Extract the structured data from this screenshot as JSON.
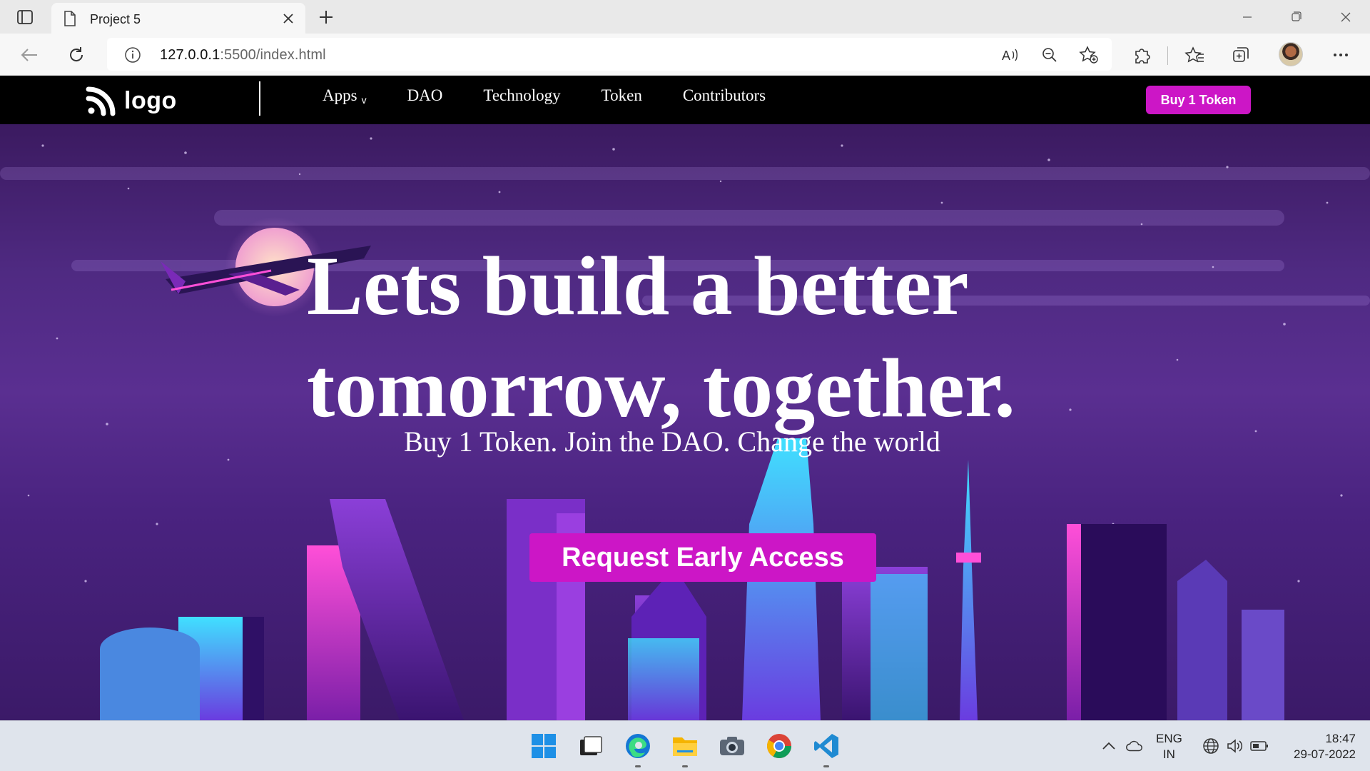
{
  "browser": {
    "tab_title": "Project 5",
    "url_host": "127.0.0.1",
    "url_path": ":5500/index.html"
  },
  "site": {
    "logo_text": "logo",
    "nav": [
      {
        "label": "Apps",
        "caret": "v"
      },
      {
        "label": "DAO"
      },
      {
        "label": "Technology"
      },
      {
        "label": "Token"
      },
      {
        "label": "Contributors"
      }
    ],
    "buy_button": "Buy 1 Token",
    "hero": {
      "title_line1": "Lets build a better",
      "title_line2": "tomorrow, together.",
      "subtitle": "Buy 1 Token. Join the DAO. Change the world",
      "cta": "Request Early Access"
    },
    "colors": {
      "accent": "#cc16c6",
      "nav_bg": "#000000",
      "hero_bg": "#4f2a82"
    }
  },
  "taskbar": {
    "lang_line1": "ENG",
    "lang_line2": "IN",
    "time": "18:47",
    "date": "29-07-2022",
    "apps": [
      "windows-start-icon",
      "task-view-icon",
      "edge-icon",
      "file-explorer-icon",
      "camera-icon",
      "chrome-icon",
      "vscode-icon"
    ]
  }
}
